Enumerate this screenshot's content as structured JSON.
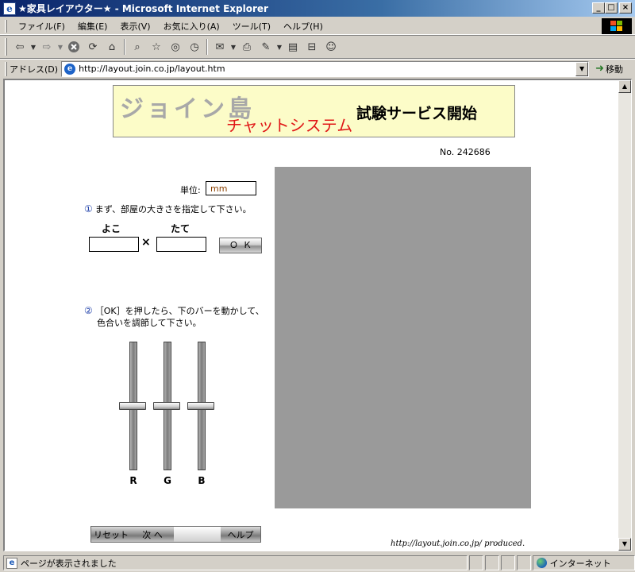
{
  "window": {
    "title": "★家具レイアウター★ - Microsoft Internet Explorer",
    "min": "_",
    "max": "□",
    "close": "×"
  },
  "menu": {
    "items": [
      "ファイル(F)",
      "編集(E)",
      "表示(V)",
      "お気に入り(A)",
      "ツール(T)",
      "ヘルプ(H)"
    ]
  },
  "address": {
    "label": "アドレス(D)",
    "url": "http://layout.join.co.jp/layout.htm",
    "go_label": "移動"
  },
  "banner": {
    "title": "ジョイン島",
    "subtitle": "チャットシステム",
    "service": "試験サービス開始"
  },
  "page": {
    "number": "No. 242686",
    "unit_label": "単位:",
    "unit_value": "mm",
    "step1_num": "①",
    "step1_text": "まず、部屋の大きさを指定して下さい。",
    "yoko": "よこ",
    "tate": "たて",
    "times": "×",
    "ok": "ＯＫ",
    "step2_num": "②",
    "step2_line1": "［OK］を押したら、下のバーを動かして、",
    "step2_line2": "色合いを調節して下さい。",
    "sliders": [
      {
        "label": "R",
        "level": 0.5
      },
      {
        "label": "G",
        "level": 0.5
      },
      {
        "label": "B",
        "level": 0.5
      }
    ],
    "preview_color": "#9a9a9a",
    "reset": "リセット",
    "next": "次 へ",
    "help": "ヘルプ",
    "credit": "http://layout.join.co.jp/  produced."
  },
  "status": {
    "text": "ページが表示されました",
    "zone": "インターネット"
  },
  "colors": {
    "titlebar": "#0a246a",
    "banner_bg": "#fcfcc8",
    "banner_red": "#e01818",
    "step_number": "#1c3ea8"
  }
}
